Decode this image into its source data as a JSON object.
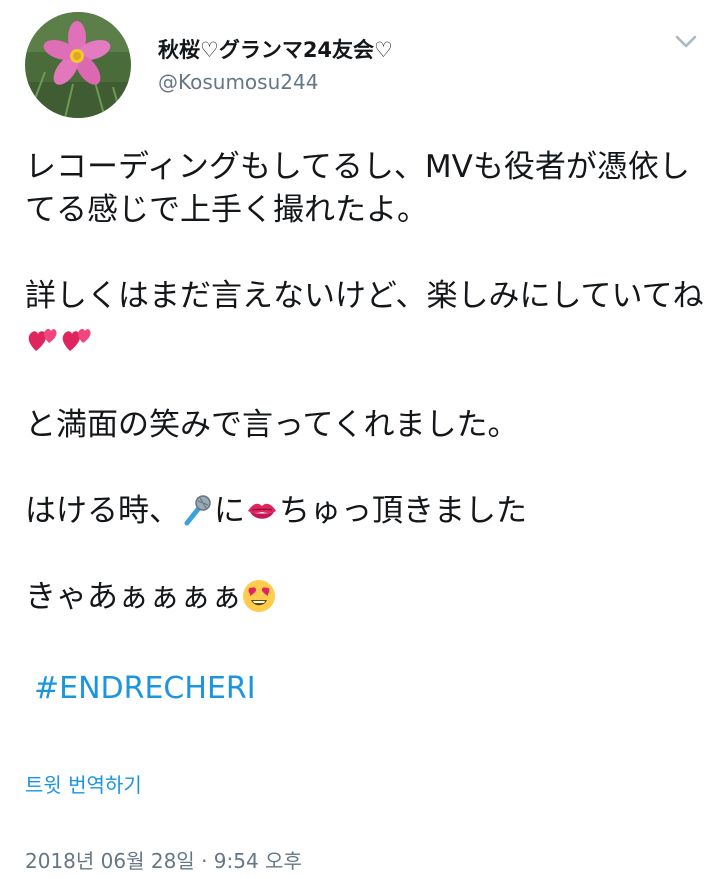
{
  "user": {
    "display_name": "秋桜♡グランマ24友会♡",
    "handle": "@Kosumosu244"
  },
  "tweet": {
    "line1": "レコーディングもしてるし、MVも役者が憑依してる感じで上手く撮れたよ。",
    "line2a": "詳しくはまだ言えないけど、楽しみにしていてね",
    "line3": "と満面の笑みで言ってくれました。",
    "line4a": "はける時、",
    "line4b": "に",
    "line4c": "ちゅっ頂きました",
    "line5": "きゃあぁぁぁぁ",
    "hashtag": "#ENDRECHERI",
    "translate_label": "트윗 번역하기",
    "timestamp": "2018년 06월 28일 · 9:54 오후"
  },
  "icons": {
    "caret": "chevron-down-icon",
    "hearts": "two-hearts-emoji",
    "mic": "microphone-emoji",
    "lips": "kiss-mark-emoji",
    "heart_eyes": "heart-eyes-emoji"
  },
  "colors": {
    "link": "#1b95e0",
    "secondary": "#657786",
    "text": "#14171a"
  }
}
